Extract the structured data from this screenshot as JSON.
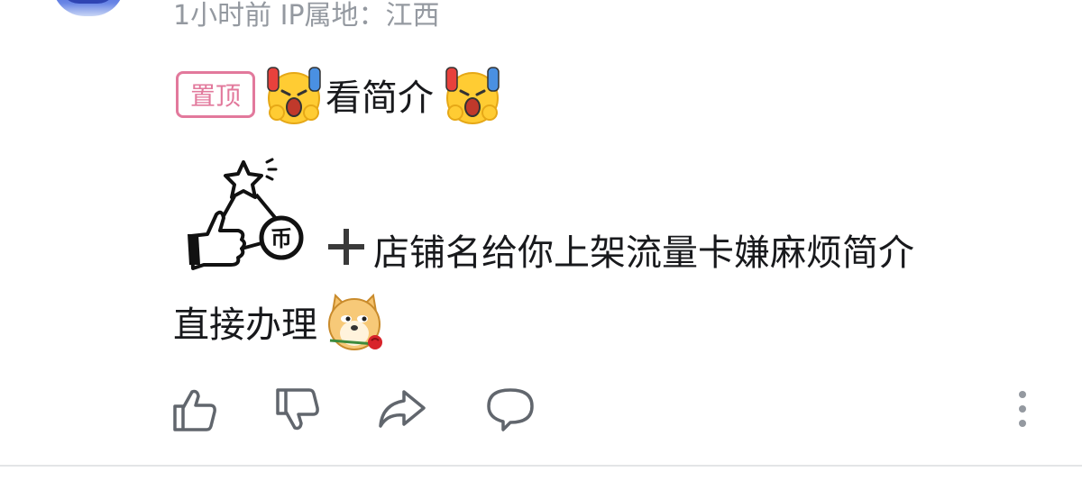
{
  "comment": {
    "meta_text": "1小时前  IP属地：江西",
    "pin_label": "置顶",
    "line1_text": "看简介",
    "line2_text": "店铺名给你上架流量卡嫌麻烦简介",
    "line3_text": "直接办理",
    "emojis": [
      "scream-face-emoji",
      "thumbs-up-coin-sticker",
      "plus-icon",
      "dog-rose-emoji"
    ]
  },
  "actions": {
    "icons": [
      "thumbs-up-icon",
      "thumbs-down-icon",
      "share-icon",
      "reply-icon",
      "more-icon"
    ]
  },
  "colors": {
    "pin_accent": "#e2799c",
    "meta_text": "#9499a0",
    "body_text": "#18191c",
    "icon_gray": "#61666d",
    "divider": "#e3e5e7"
  }
}
